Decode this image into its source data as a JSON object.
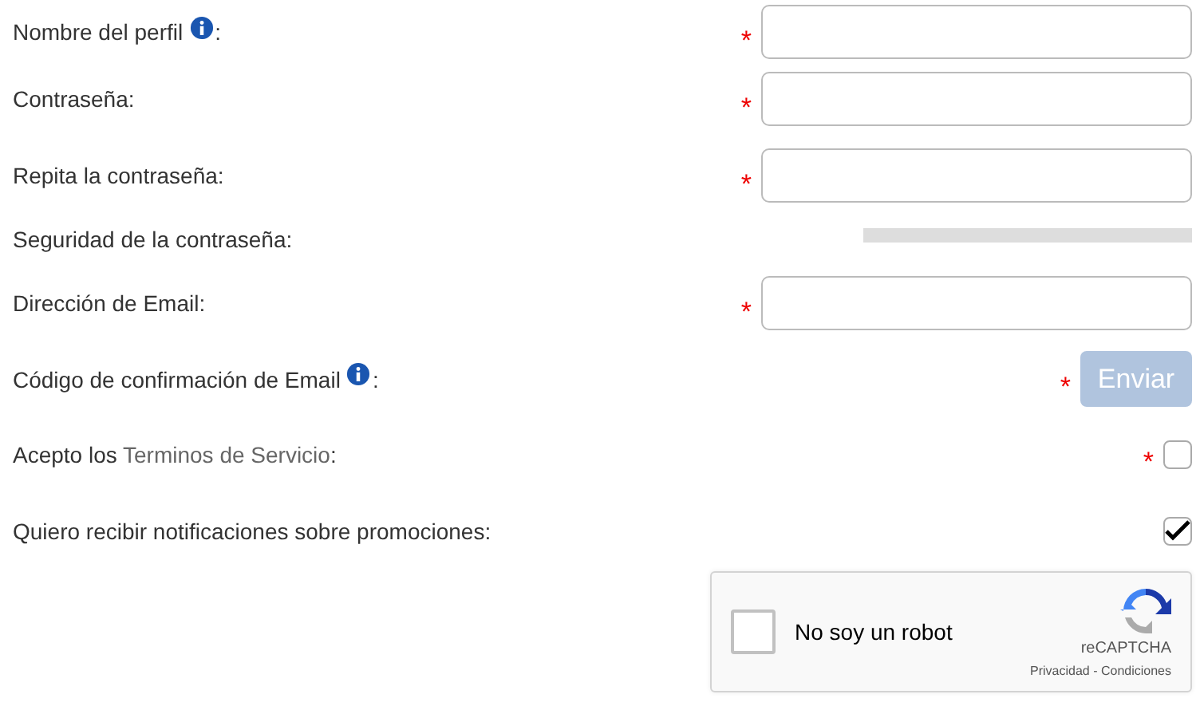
{
  "form": {
    "rows": [
      {
        "kind": "text",
        "label": {
          "text": "Nombre del perfil",
          "info": true,
          "suffix": ":"
        },
        "marker": "*"
      },
      {
        "kind": "text",
        "label": {
          "text": "Contraseña:",
          "info": false
        },
        "marker": "*"
      },
      {
        "kind": "text",
        "label": {
          "text": "Repita la contraseña:",
          "info": false
        },
        "marker": "*"
      },
      {
        "kind": "meter",
        "label": {
          "text": "Seguridad de la contraseña:",
          "info": false
        },
        "level": 0
      },
      {
        "kind": "text",
        "label": {
          "text": "Dirección de Email:",
          "info": false
        },
        "marker": "*"
      },
      {
        "kind": "button",
        "label": {
          "text": "Código de confirmación de Email",
          "info": true,
          "suffix": ":"
        },
        "marker": "*",
        "button": "Enviar",
        "disabled": true
      },
      {
        "kind": "checkbox",
        "label": {
          "text": "Acepto los ",
          "link": "Terminos de Servicio",
          "suffix": ":",
          "info": false
        },
        "marker": "*",
        "checked": false
      },
      {
        "kind": "checkbox",
        "label": {
          "text": "Quiero recibir notificaciones sobre promociones:",
          "info": false
        },
        "checked": true
      }
    ]
  },
  "captcha": {
    "label": "No soy un robot",
    "checked": false,
    "brand": "reCAPTCHA",
    "links": "Privacidad - Condiciones"
  }
}
